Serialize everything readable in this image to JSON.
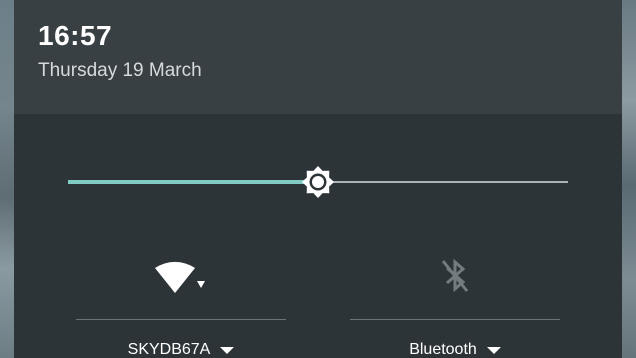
{
  "status": {
    "time": "16:57",
    "date": "Thursday 19 March"
  },
  "brightness": {
    "level_fraction": 0.5,
    "icon": "brightness-icon",
    "fill_color": "#80cbc4",
    "track_color": "#aab3b7"
  },
  "tiles": {
    "wifi": {
      "label": "SKYDB67A",
      "icon": "wifi-icon",
      "state": "connected"
    },
    "bluetooth": {
      "label": "Bluetooth",
      "icon": "bluetooth-disabled-icon",
      "state": "off"
    }
  },
  "colors": {
    "header_bg": "#394043",
    "panel_bg": "#2d3437",
    "accent": "#80cbc4"
  }
}
